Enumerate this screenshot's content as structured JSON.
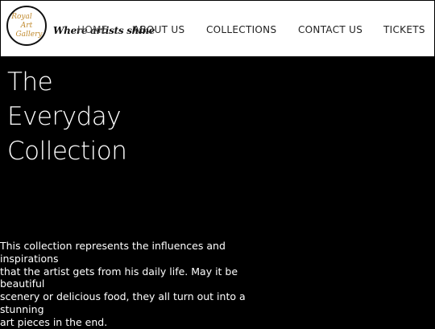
{
  "header": {
    "logo": {
      "line1": "Royal",
      "line2": "Art",
      "line3": "Gallery"
    },
    "tagline": "Where artists shine",
    "nav": {
      "home": "HOME",
      "about": "ABOUT US",
      "collections": "COLLECTIONS",
      "contact": "CONTACT US",
      "tickets": "TICKETS"
    }
  },
  "main": {
    "title_lines": [
      "The",
      "Everyday",
      "Collection"
    ],
    "description_lines": [
      "This collection represents the influences and",
      "inspirations",
      "that the artist gets from his daily life. May it be",
      "beautiful",
      "scenery or delicious food, they all turn out into a",
      "stunning",
      "art pieces in the end."
    ]
  },
  "colors": {
    "background": "#000000",
    "header_bg": "#ffffff",
    "logo_gold": "#c08a2e"
  }
}
